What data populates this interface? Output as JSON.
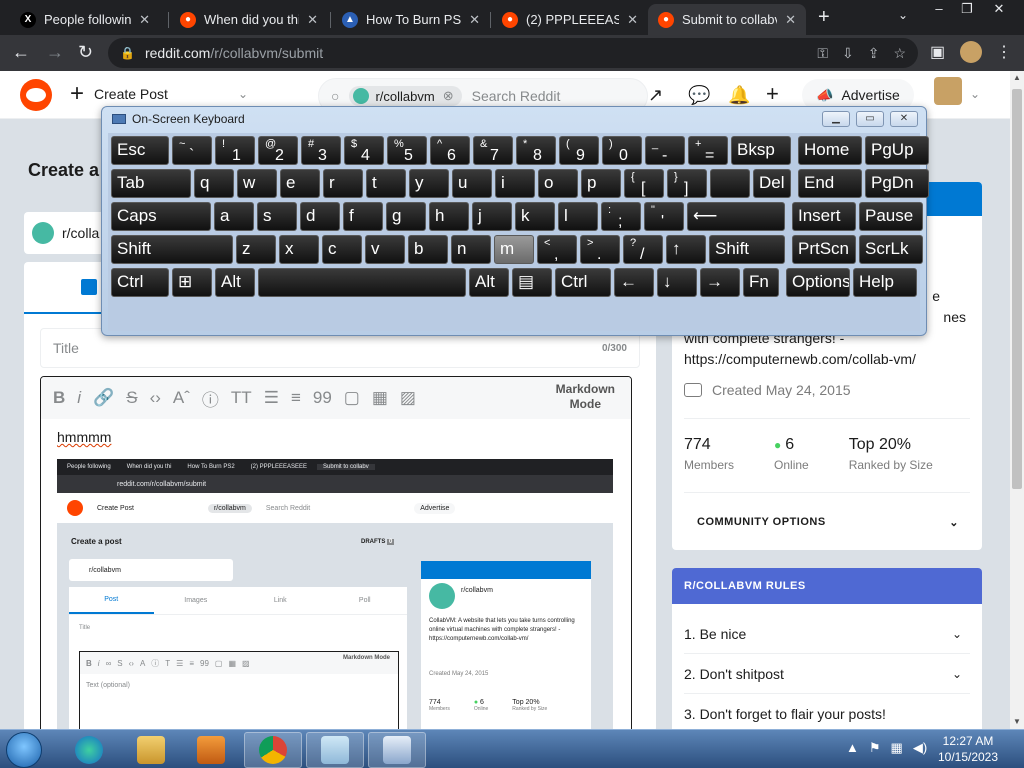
{
  "browser": {
    "tabs": [
      {
        "title": "People following",
        "favicon": "x-icon",
        "color": "#000000"
      },
      {
        "title": "When did you thi",
        "favicon": "reddit-icon",
        "color": "#ff4500"
      },
      {
        "title": "How To Burn PS2",
        "favicon": "forum-icon",
        "color": "#2b5fb4"
      },
      {
        "title": "(2) PPPLEEEASEEE",
        "favicon": "reddit-icon",
        "color": "#ff4500"
      },
      {
        "title": "Submit to collabv",
        "favicon": "reddit-icon",
        "color": "#ff4500"
      }
    ],
    "url_host": "reddit.com",
    "url_path": "/r/collabvm/submit"
  },
  "header": {
    "create_post": "Create Post",
    "search_chip": "r/collabvm",
    "search_placeholder": "Search Reddit",
    "advertise": "Advertise"
  },
  "main": {
    "page_title": "Create a",
    "community": "r/colla",
    "title_placeholder": "Title",
    "title_count": "0/300",
    "markdown_mode_line1": "Markdown",
    "markdown_mode_line2": "Mode",
    "body_text": "hmmmm"
  },
  "embedded": {
    "tabs": [
      "People following",
      "When did you thi",
      "How To Burn PS2",
      "(2) PPPLEEEASEEE",
      "Submit to collabv"
    ],
    "url": "reddit.com/r/collabvm/submit",
    "create_post": "Create Post",
    "search_chip": "r/collabvm",
    "search_placeholder": "Search Reddit",
    "advertise": "Advertise",
    "page_title": "Create a post",
    "drafts": "DRAFTS",
    "drafts_count": "0",
    "community": "r/collabvm",
    "tabs_post": [
      "Post",
      "Images",
      "Link",
      "Poll"
    ],
    "title_placeholder": "Title",
    "markdown_mode": "Markdown Mode",
    "text_placeholder": "Text (optional)",
    "side_name": "r/collabvm",
    "side_desc": "CollabVM: A website that lets you take turns controlling online virtual machines with complete strangers! - https://computernewb.com/collab-vm/",
    "side_created": "Created May 24, 2015",
    "side_members": "774",
    "side_members_label": "Members",
    "side_online": "6",
    "side_online_label": "Online",
    "side_rank": "Top 20%",
    "side_rank_label": "Ranked by Size"
  },
  "sidebar": {
    "desc_line1": "e",
    "desc_line2": "nes",
    "desc_line3": "with complete strangers! -",
    "desc_line4": "https://computernewb.com/collab-vm/",
    "created": "Created May 24, 2015",
    "members": "774",
    "members_label": "Members",
    "online": "6",
    "online_label": "Online",
    "rank": "Top 20%",
    "rank_label": "Ranked by Size",
    "community_options": "COMMUNITY OPTIONS"
  },
  "rules": {
    "heading": "R/COLLABVM RULES",
    "items": [
      "1. Be nice",
      "2. Don't shitpost",
      "3. Don't forget to flair your posts!"
    ]
  },
  "osk": {
    "title": "On-Screen Keyboard"
  },
  "taskbar": {
    "time": "12:27 AM",
    "date": "10/15/2023"
  },
  "colors": {
    "reddit_orange": "#ff4500",
    "reddit_blue": "#0079d3",
    "rules_header": "#4f69d3",
    "online_green": "#46d160"
  }
}
